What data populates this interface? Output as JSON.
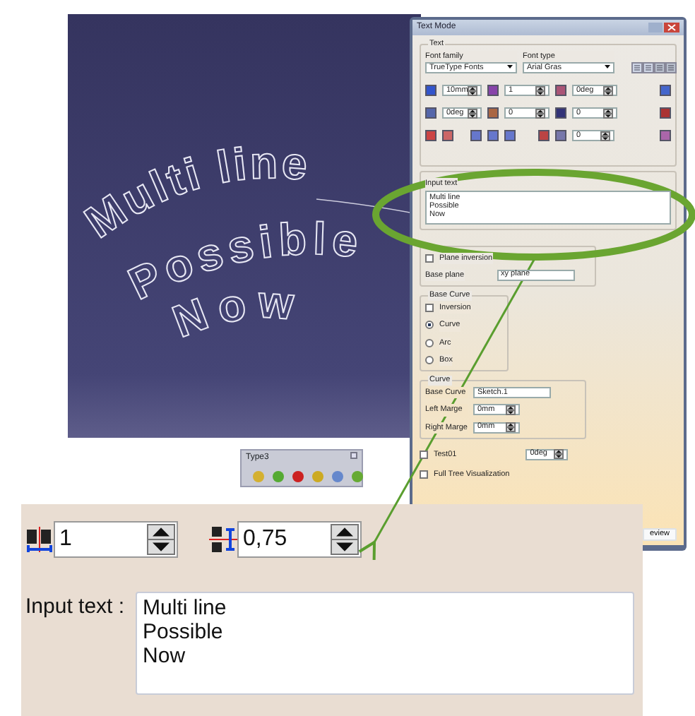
{
  "viewport": {
    "lines": [
      "Multi line",
      "Possible",
      "Now"
    ]
  },
  "dialog": {
    "title": "Text Mode",
    "group_text": "Text",
    "font_family_label": "Font family",
    "font_family": "TrueType Fonts",
    "font_type_label": "Font type",
    "font_type": "Arial Gras",
    "spin_rows": [
      [
        "10mm",
        "1",
        "0deg"
      ],
      [
        "0deg",
        "0",
        "0"
      ]
    ],
    "spin_single": "0",
    "input_text_label": "Input text",
    "input_text": [
      "Multi line",
      "Possible",
      "Now"
    ],
    "plane_inversion": {
      "label": "Plane inversion",
      "checked": false
    },
    "base_plane_label": "Base plane",
    "base_plane": "xy plane",
    "base_curve": {
      "legend": "Base Curve",
      "inversion": {
        "label": "Inversion",
        "checked": false
      },
      "options": [
        {
          "label": "Curve",
          "selected": true
        },
        {
          "label": "Arc",
          "selected": false
        },
        {
          "label": "Box",
          "selected": false
        }
      ]
    },
    "curve": {
      "legend": "Curve",
      "fields": [
        {
          "label": "Base Curve",
          "value": "Sketch.1",
          "kind": "text"
        },
        {
          "label": "Left Marge",
          "value": "0mm",
          "kind": "spin"
        },
        {
          "label": "Right Marge",
          "value": "0mm",
          "kind": "spin"
        }
      ]
    },
    "test01": {
      "label": "Test01",
      "checked": false,
      "value": "0deg"
    },
    "full_tree": {
      "label": "Full Tree Visualization",
      "checked": false
    },
    "preview_button": "eview"
  },
  "toolbar": {
    "title": "Type3"
  },
  "inset": {
    "spins": [
      "1",
      "0,75"
    ],
    "input_text_label": "Input text :",
    "input_text": [
      "Multi line",
      "Possible",
      "Now"
    ]
  }
}
